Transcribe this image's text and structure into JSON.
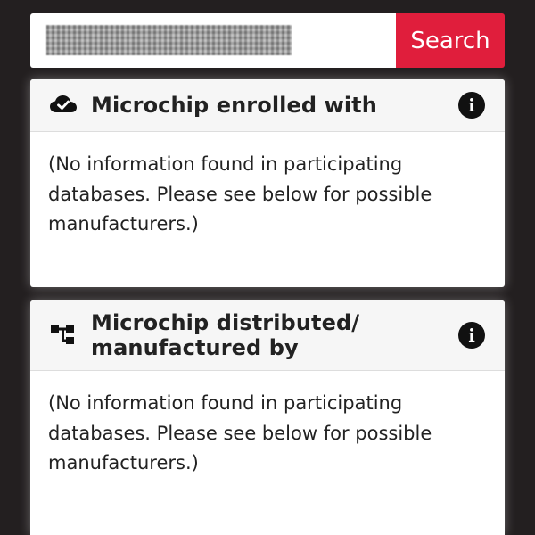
{
  "search": {
    "button_label": "Search"
  },
  "cards": [
    {
      "title": "Microchip enrolled with",
      "info_icon": "i",
      "icon": "cloud-check-icon",
      "body": "(No information found in participating databases. Please see below for possible manufacturers.)"
    },
    {
      "title": "Microchip distributed/ manufactured by",
      "info_icon": "i",
      "icon": "hierarchy-icon",
      "body": "(No information found in participating databases. Please see below for possible manufacturers.)"
    }
  ],
  "colors": {
    "background": "#231f20",
    "accent": "#e01e3c",
    "card": "#ffffff",
    "card_header": "#f6f6f6"
  }
}
